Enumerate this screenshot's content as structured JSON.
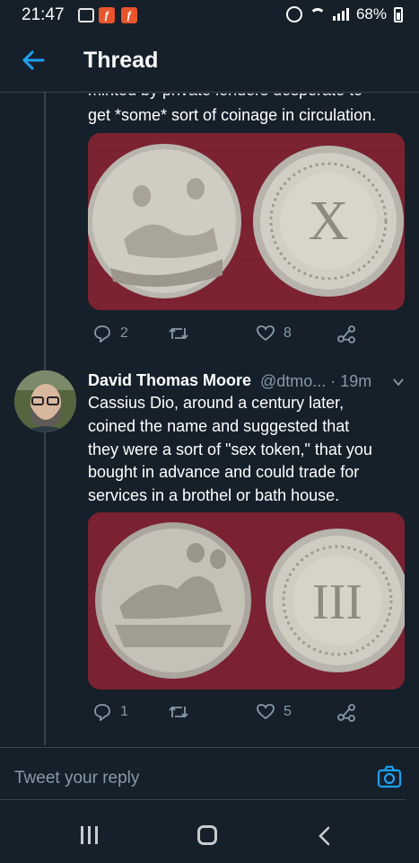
{
  "status_bar": {
    "time": "21:47",
    "battery": "68%"
  },
  "header": {
    "title": "Thread"
  },
  "tweet1": {
    "text_cut": "minted by private lenders desperate to",
    "text_last": "get *some* sort of coinage in circulation.",
    "replies": "2",
    "likes": "8"
  },
  "tweet2": {
    "author_name": "David Thomas Moore",
    "author_meta": "@dtmo... · 19m",
    "text_lines": [
      "Cassius Dio, around a century later,",
      "coined the name and suggested that",
      "they were a sort of \"sex token,\" that you",
      "bought in advance and could trade for",
      "services in a brothel or bath house."
    ],
    "replies": "1",
    "likes": "5",
    "coin_numeral": "III"
  },
  "tweet1_coin_numeral": "X",
  "reply_bar": {
    "placeholder": "Tweet your reply"
  },
  "colors": {
    "background": "#15202b",
    "accent": "#1da1f2",
    "muted": "#8899a6",
    "divider": "#38444d"
  },
  "icons": [
    "back-arrow-icon",
    "reply-icon",
    "retweet-icon",
    "like-icon",
    "share-icon",
    "chevron-down-icon",
    "camera-icon"
  ]
}
